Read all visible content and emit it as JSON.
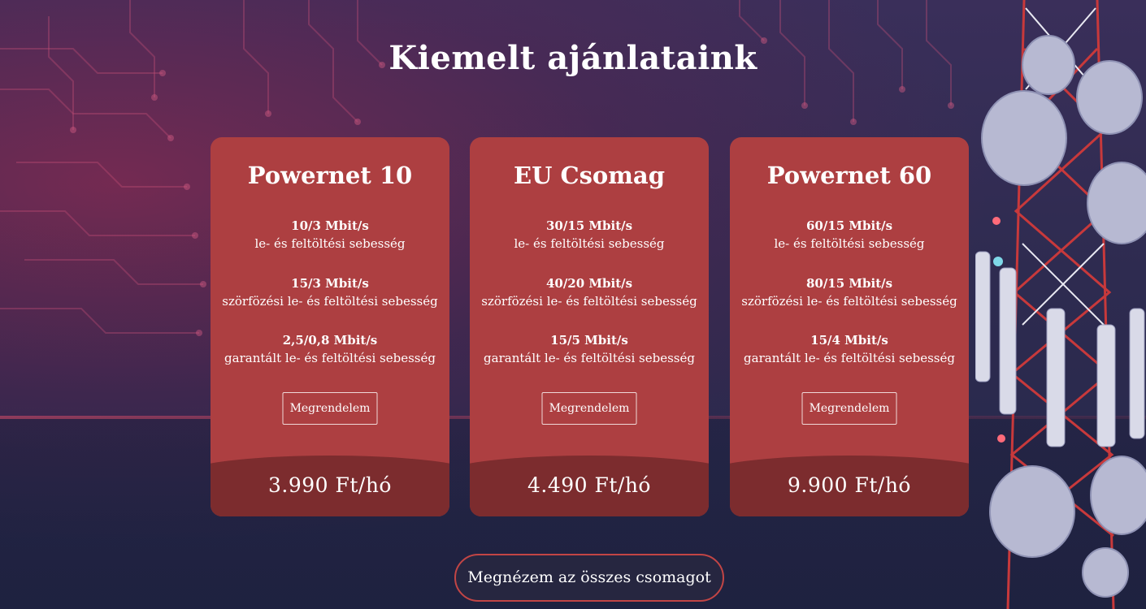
{
  "section": {
    "heading": "Kiemelt ajánlataink"
  },
  "cards": [
    {
      "title": "Powernet 10",
      "specs": [
        {
          "value": "10/3 Mbit/s",
          "label": "le- és feltöltési sebesség"
        },
        {
          "value": "15/3 Mbit/s",
          "label": "szörfözési le- és feltöltési sebesség"
        },
        {
          "value": "2,5/0,8 Mbit/s",
          "label": "garantált le- és feltöltési sebesség"
        }
      ],
      "button": "Megrendelem",
      "price": "3.990 Ft/hó"
    },
    {
      "title": "EU Csomag",
      "specs": [
        {
          "value": "30/15 Mbit/s",
          "label": "le- és feltöltési sebesség"
        },
        {
          "value": "40/20 Mbit/s",
          "label": "szörfözési le- és feltöltési sebesség"
        },
        {
          "value": "15/5 Mbit/s",
          "label": "garantált le- és feltöltési sebesség"
        }
      ],
      "button": "Megrendelem",
      "price": "4.490 Ft/hó"
    },
    {
      "title": "Powernet 60",
      "specs": [
        {
          "value": "60/15 Mbit/s",
          "label": "le- és feltöltési sebesség"
        },
        {
          "value": "80/15 Mbit/s",
          "label": "szörfözési le- és feltöltési sebesség"
        },
        {
          "value": "15/4 Mbit/s",
          "label": "garantált le- és feltöltési sebesség"
        }
      ],
      "button": "Megrendelem",
      "price": "9.900 Ft/hó"
    }
  ],
  "all_packages_button": "Megnézem az összes csomagot",
  "colors": {
    "card": "#ad3f41",
    "price_band": "#7c2c2e",
    "button_border": "#c24545",
    "background": "#2e2b50"
  },
  "icons": [
    "circuit-board-background",
    "cell-tower-illustration"
  ]
}
